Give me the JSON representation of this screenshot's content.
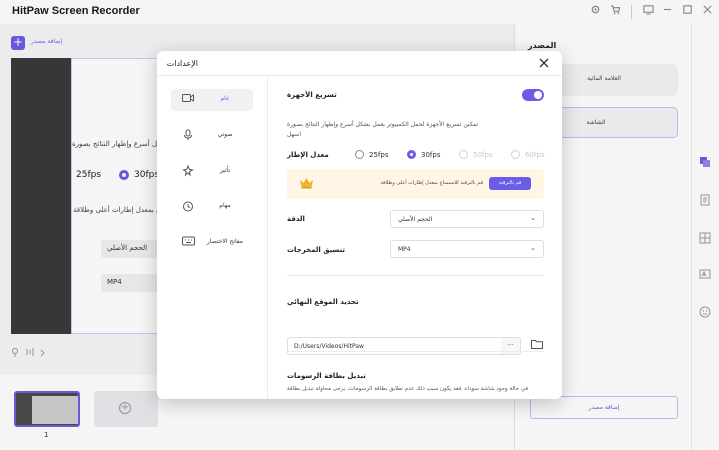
{
  "app": {
    "title": "HitPaw Screen Recorder"
  },
  "titlebar_icons": [
    "gear-icon",
    "cart-icon",
    "display-icon",
    "minimize-icon",
    "maximize-icon",
    "close-icon"
  ],
  "colors": {
    "accent": "#6c5ce7",
    "upsell_bg": "#fff6e5",
    "crown": "#f0b429"
  },
  "top": {
    "add_source_label": "إضافة مصدر"
  },
  "background_ghost": {
    "desc_line": "شكل أسرع وإظهار النتائج بصورة",
    "fps_25": "25fps",
    "fps_30": "30fps",
    "upsell_line": "اع بمعدل إطارات أعلى وطلاقة",
    "resolution_value": "الحجم الأصلي",
    "format_value": "MP4"
  },
  "thumbnails": {
    "first_number": "1"
  },
  "right_panel": {
    "title": "المصدر",
    "card_1": "العلامة المائية",
    "card_2": "الشاشة",
    "add_source_button": "إضافة مصدر"
  },
  "dialog": {
    "title": "الإعدادات",
    "nav": [
      {
        "label": "عام",
        "icon": "camera-icon",
        "active": true
      },
      {
        "label": "صوتي",
        "icon": "microphone-icon",
        "active": false
      },
      {
        "label": "تأثير",
        "icon": "sparkle-icon",
        "active": false
      },
      {
        "label": "مهام",
        "icon": "clock-icon",
        "active": false
      },
      {
        "label": "مفاتح الاختصار",
        "icon": "keyboard-icon",
        "active": false
      }
    ],
    "hw_accel": {
      "label": "تسريع الأجهزة",
      "enabled": true,
      "desc_line1": "تمكين تسريع الأجهزة لحمل الكمبيوتر يعمل بشكل أسرع وإظهار النتائج بصورة",
      "desc_line2": "اسهل"
    },
    "frame_rate": {
      "label": "معدل الإطار",
      "options": [
        {
          "label": "25fps",
          "state": "available"
        },
        {
          "label": "30fps",
          "state": "selected"
        },
        {
          "label": "50fps",
          "state": "disabled"
        },
        {
          "label": "60fps",
          "state": "disabled"
        }
      ]
    },
    "upsell": {
      "button": "قم بالترقية",
      "text": "قم بالترقية للاستمتاع بمعدل إطارات أعلى وطلاقة"
    },
    "resolution": {
      "label": "الدقة",
      "value": "الحجم الأصلي"
    },
    "output_format": {
      "label": "تنسيق المخرجات",
      "value": "MP4"
    },
    "destination": {
      "label": "تحديد الموقع النهائي",
      "path": "D:/Users/Videos/HitPaw",
      "more_button": "···"
    },
    "gpu_switch": {
      "label": "تبديل بطاقة الرسومات",
      "desc": "في حالة وجود شاشة سوداء، فقد يكون سبب ذلك عدم تطابق بطاقة الرسومات، يرجى محاولة تبديل بطاقة"
    }
  }
}
